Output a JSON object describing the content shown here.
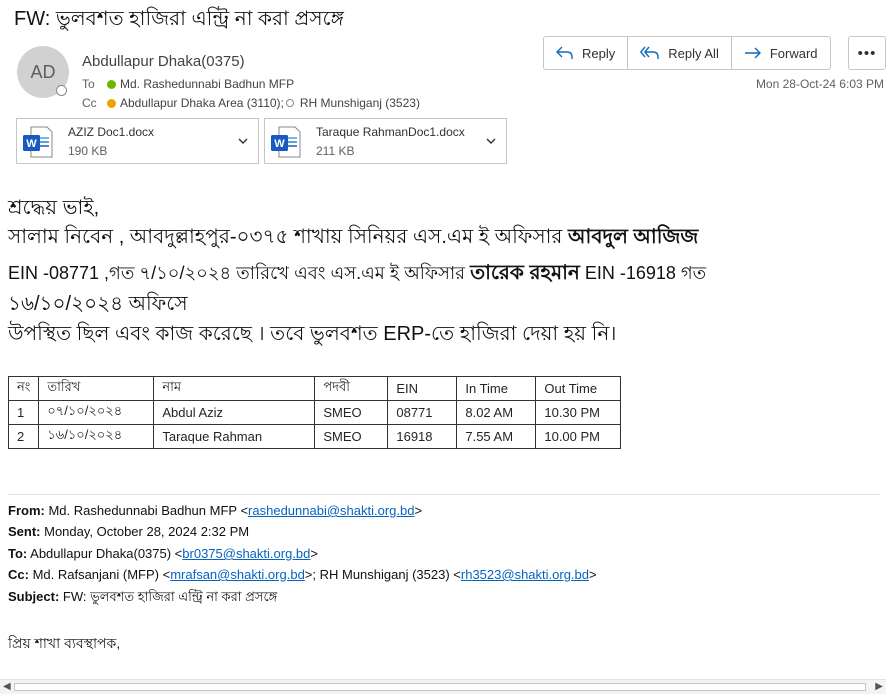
{
  "subject": "FW: ভুলবশত হাজিরা এন্ট্রি না করা প্রসঙ্গে",
  "sender": {
    "initials": "AD",
    "name": "Abdullapur Dhaka(0375)"
  },
  "to": {
    "label": "To",
    "name": "Md. Rashedunnabi Badhun MFP"
  },
  "cc": {
    "label": "Cc",
    "name1": "Abdullapur Dhaka Area (3110);",
    "name2": "RH Munshiganj (3523)"
  },
  "actions": {
    "reply": "Reply",
    "reply_all": "Reply All",
    "forward": "Forward",
    "more": "•••"
  },
  "received": "Mon 28-Oct-24 6:03 PM",
  "attachments": [
    {
      "name": "AZIZ  Doc1.docx",
      "size": "190 KB",
      "icon": "word-doc-icon"
    },
    {
      "name": "Taraque RahmanDoc1.docx",
      "size": "211 KB",
      "icon": "word-doc-icon"
    }
  ],
  "body": {
    "greeting": "শ্রদ্ধেয় ভাই,",
    "line1_a": "সালাম  নিবেন , আবদুল্লাহপুর-০৩৭৫  শাখায়  সিনিয়র  এস.এম  ই  অফিসার  ",
    "line1_bold": "আবদুল আজিজ",
    "line2_a": "EIN -08771 ,গত ৭/১০/২০২৪ তারিখে এবং এস.এম  ই  অফিসার  ",
    "line2_bold": "তারেক রহমান",
    "line2_b": " EIN -16918  গত",
    "line3": "১৬/১০/২০২৪ অফিসে",
    "line4": "উপস্থিত ছিল এবং কাজ করেছে । তবে ভুলবশত ERP-তে হাজিরা দেয়া হয় নি।"
  },
  "table": {
    "headers": [
      "নং",
      "তারিখ",
      "নাম",
      "পদবী",
      "EIN",
      "In Time",
      "Out Time"
    ],
    "rows": [
      [
        "1",
        "০৭/১০/২০২৪",
        "Abdul Aziz",
        "SMEO",
        "08771",
        "8.02 AM",
        "10.30 PM"
      ],
      [
        "2",
        "১৬/১০/২০২৪",
        "Taraque Rahman",
        "SMEO",
        "16918",
        "7.55 AM",
        "10.00 PM"
      ]
    ]
  },
  "forwarded": {
    "from_label": "From:",
    "from_name": " Md. Rashedunnabi Badhun MFP <",
    "from_email": "rashedunnabi@shakti.org.bd",
    "sent_label": "Sent:",
    "sent_value": " Monday, October 28, 2024 2:32 PM",
    "to_label": "To:",
    "to_name": " Abdullapur Dhaka(0375) <",
    "to_email": "br0375@shakti.org.bd",
    "cc_label": "Cc:",
    "cc_name1": " Md. Rafsanjani (MFP) <",
    "cc_email1": "mrafsan@shakti.org.bd",
    "cc_name2": ">; RH Munshiganj (3523) <",
    "cc_email2": "rh3523@shakti.org.bd",
    "subject_label": "Subject:",
    "subject_value": " FW: ভুলবশত হাজিরা এন্ট্রি না করা প্রসঙ্গে",
    "closing": ">",
    "salutation": "প্রিয় শাখা ব্যবস্থাপক,"
  },
  "colors": {
    "accent": "#0f6cbd",
    "link": "#0563c1",
    "online": "#6bb700",
    "away": "#eaa300",
    "word": "#185abd"
  }
}
